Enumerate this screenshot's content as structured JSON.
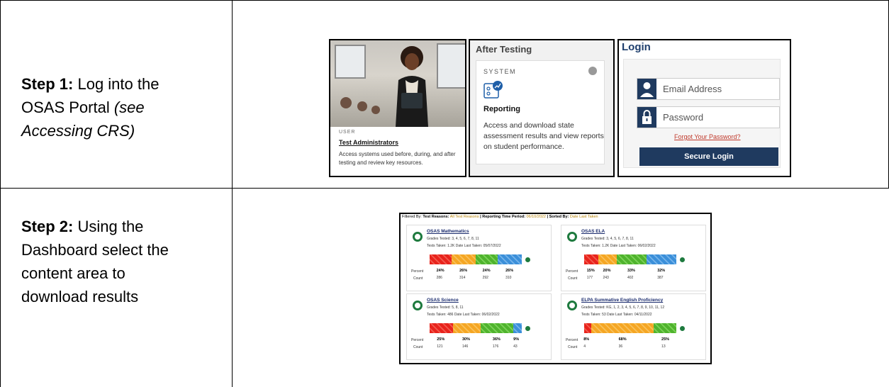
{
  "step1": {
    "label": "Step 1:",
    "text_line1": " Log into the",
    "text_line2": "OSAS Portal ",
    "italic_line2": "(see",
    "italic_line3": "Accessing CRS)"
  },
  "step2": {
    "label": "Step 2:",
    "text_line1": " Using the",
    "text_line2": "Dashboard select the",
    "text_line3": "content area to",
    "text_line4": "download results"
  },
  "user_card": {
    "role": "USER",
    "title": "Test Administrators",
    "description": "Access systems used before, during, and after testing and review key resources."
  },
  "after_testing": {
    "header": "After Testing",
    "system_label": "SYSTEM",
    "system_name": "Reporting",
    "description": "Access and download state assessment results and view reports on student performance."
  },
  "login": {
    "header": "Login",
    "email_placeholder": "Email Address",
    "password_placeholder": "Password",
    "forgot_link": "Forgot Your Password?",
    "submit_label": "Secure Login"
  },
  "dashboard": {
    "filter_prefix": "Filtered By: ",
    "filter_reasons_label": "Test Reasons:",
    "filter_reasons_value": " All Test Reasons",
    "filter_period_label": " | Reporting Time Period:",
    "filter_period_value": " 06/10/2022",
    "filter_sort_label": " | Sorted By:",
    "filter_sort_value": " Date Last Taken",
    "percent_label": "Percent",
    "count_label": "Count",
    "tiles": [
      {
        "name": "OSAS Mathematics",
        "grades": "Grades Tested: 3, 4, 5, 6, 7, 8, 11",
        "taken": "Tests Taken: 1.2K      Date Last Taken: 05/07/2022",
        "percents": [
          "24%",
          "26%",
          "24%",
          "26%"
        ],
        "counts": [
          "286",
          "314",
          "292",
          "310"
        ],
        "fractions": [
          0.24,
          0.26,
          0.24,
          0.26
        ],
        "colors": [
          "red",
          "orange",
          "green",
          "blue"
        ]
      },
      {
        "name": "OSAS ELA",
        "grades": "Grades Tested: 3, 4, 5, 6, 7, 8, 11",
        "taken": "Tests Taken: 1.2K      Date Last Taken: 06/02/2022",
        "percents": [
          "15%",
          "20%",
          "33%",
          "32%"
        ],
        "counts": [
          "177",
          "243",
          "402",
          "387"
        ],
        "fractions": [
          0.15,
          0.2,
          0.33,
          0.32
        ],
        "colors": [
          "red",
          "orange",
          "green",
          "blue"
        ]
      },
      {
        "name": "OSAS Science",
        "grades": "Grades Tested: 5, 8, 11",
        "taken": "Tests Taken: 486      Date Last Taken: 06/02/2022",
        "percents": [
          "25%",
          "30%",
          "36%",
          "9%"
        ],
        "counts": [
          "121",
          "146",
          "176",
          "43"
        ],
        "fractions": [
          0.25,
          0.3,
          0.36,
          0.09
        ],
        "colors": [
          "red",
          "orange",
          "green",
          "blue"
        ]
      },
      {
        "name": "ELPA Summative English Proficiency",
        "grades": "Grades Tested: KG, 1, 2, 3, 4, 5, 6, 7, 8, 9, 10, 11, 12",
        "taken": "Tests Taken: 53      Date Last Taken: 04/11/2022",
        "percents": [
          "8%",
          "68%",
          "25%"
        ],
        "counts": [
          "4",
          "36",
          "13"
        ],
        "fractions": [
          0.08,
          0.68,
          0.25
        ],
        "colors": [
          "red",
          "orange",
          "green"
        ]
      }
    ]
  }
}
